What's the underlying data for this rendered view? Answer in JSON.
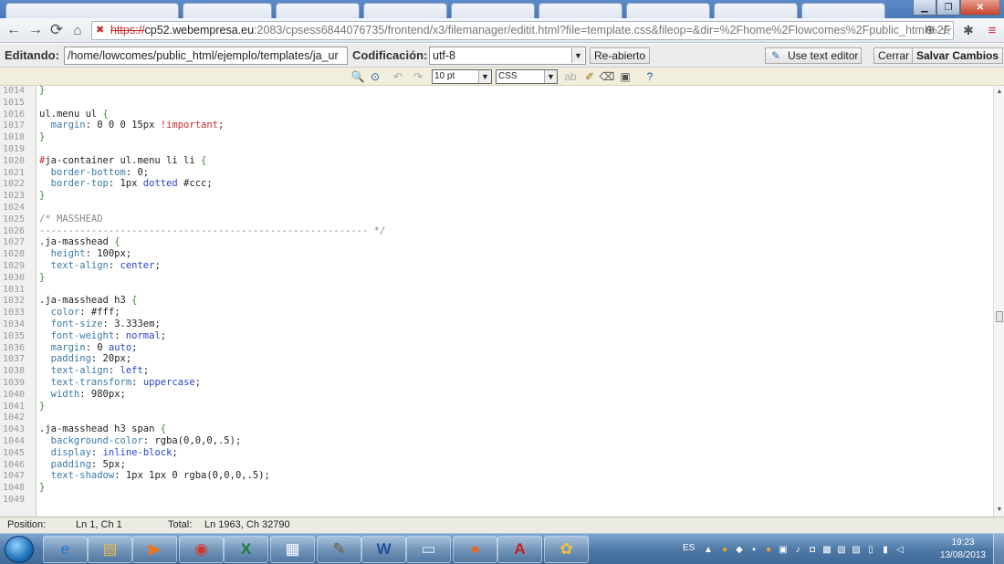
{
  "browser": {
    "url_scheme": "https://",
    "url_host": "cp52.webempresa.eu",
    "url_rest": ":2083/cpsess6844076735/frontend/x3/filemanager/editit.html?file=template.css&fileop=&dir=%2Fhome%2Flowcomes%2Fpublic_html%2F",
    "icons": {
      "back": "back-arrow-icon",
      "forward": "forward-arrow-icon",
      "reload": "reload-icon",
      "home": "home-icon",
      "lock": "broken-lock-icon",
      "zoom": "zoom-icon",
      "star": "star-icon",
      "menu": "menu-icon"
    }
  },
  "editor_toolbar": {
    "editing_label": "Editando:",
    "path_value": "/home/lowcomes/public_html/ejemplo/templates/ja_ur",
    "encoding_label": "Codificación:",
    "encoding_value": "utf-8",
    "reopen_button": "Re-abierto",
    "use_text_editor_button": "Use text editor",
    "close_button": "Cerrar",
    "save_button": "Salvar Cambios"
  },
  "code_toolbar": {
    "font_size": "10 pt",
    "syntax": "CSS"
  },
  "code_lines": [
    {
      "n": "1014",
      "parts": [
        {
          "c": "t-br",
          "t": "}"
        }
      ]
    },
    {
      "n": "1015",
      "parts": []
    },
    {
      "n": "1016",
      "parts": [
        {
          "c": "t-sel",
          "t": "ul.menu ul "
        },
        {
          "c": "t-br",
          "t": "{"
        }
      ]
    },
    {
      "n": "1017",
      "parts": [
        {
          "c": "t-prop",
          "t": "  margin"
        },
        {
          "c": "t-val",
          "t": ": 0 0 0 15px "
        },
        {
          "c": "t-imp",
          "t": "!important"
        },
        {
          "c": "t-val",
          "t": ";"
        }
      ]
    },
    {
      "n": "1018",
      "parts": [
        {
          "c": "t-br",
          "t": "}"
        }
      ]
    },
    {
      "n": "1019",
      "parts": []
    },
    {
      "n": "1020",
      "parts": [
        {
          "c": "t-hash",
          "t": "#"
        },
        {
          "c": "t-sel",
          "t": "ja-container ul.menu li li "
        },
        {
          "c": "t-br",
          "t": "{"
        }
      ]
    },
    {
      "n": "1021",
      "parts": [
        {
          "c": "t-prop",
          "t": "  border-bottom"
        },
        {
          "c": "t-val",
          "t": ": 0;"
        }
      ]
    },
    {
      "n": "1022",
      "parts": [
        {
          "c": "t-prop",
          "t": "  border-top"
        },
        {
          "c": "t-val",
          "t": ": 1px "
        },
        {
          "c": "t-kw",
          "t": "dotted"
        },
        {
          "c": "t-val",
          "t": " #ccc;"
        }
      ]
    },
    {
      "n": "1023",
      "parts": [
        {
          "c": "t-br",
          "t": "}"
        }
      ]
    },
    {
      "n": "1024",
      "parts": []
    },
    {
      "n": "1025",
      "parts": [
        {
          "c": "t-cm",
          "t": "/* MASSHEAD"
        }
      ]
    },
    {
      "n": "1026",
      "parts": [
        {
          "c": "t-cm",
          "t": "--------------------------------------------------------- */"
        }
      ]
    },
    {
      "n": "1027",
      "parts": [
        {
          "c": "t-sel",
          "t": ".ja-masshead "
        },
        {
          "c": "t-br",
          "t": "{"
        }
      ]
    },
    {
      "n": "1028",
      "parts": [
        {
          "c": "t-prop",
          "t": "  height"
        },
        {
          "c": "t-val",
          "t": ": 100px;"
        }
      ]
    },
    {
      "n": "1029",
      "parts": [
        {
          "c": "t-prop",
          "t": "  text-align"
        },
        {
          "c": "t-val",
          "t": ": "
        },
        {
          "c": "t-kw",
          "t": "center"
        },
        {
          "c": "t-val",
          "t": ";"
        }
      ]
    },
    {
      "n": "1030",
      "parts": [
        {
          "c": "t-br",
          "t": "}"
        }
      ]
    },
    {
      "n": "1031",
      "parts": []
    },
    {
      "n": "1032",
      "parts": [
        {
          "c": "t-sel",
          "t": ".ja-masshead h3 "
        },
        {
          "c": "t-br",
          "t": "{"
        }
      ]
    },
    {
      "n": "1033",
      "parts": [
        {
          "c": "t-prop",
          "t": "  color"
        },
        {
          "c": "t-val",
          "t": ": #fff;"
        }
      ]
    },
    {
      "n": "1034",
      "parts": [
        {
          "c": "t-prop",
          "t": "  font-size"
        },
        {
          "c": "t-val",
          "t": ": 3.333em;"
        }
      ]
    },
    {
      "n": "1035",
      "parts": [
        {
          "c": "t-prop",
          "t": "  font-weight"
        },
        {
          "c": "t-val",
          "t": ": "
        },
        {
          "c": "t-kw",
          "t": "normal"
        },
        {
          "c": "t-val",
          "t": ";"
        }
      ]
    },
    {
      "n": "1036",
      "parts": [
        {
          "c": "t-prop",
          "t": "  margin"
        },
        {
          "c": "t-val",
          "t": ": 0 "
        },
        {
          "c": "t-kw",
          "t": "auto"
        },
        {
          "c": "t-val",
          "t": ";"
        }
      ]
    },
    {
      "n": "1037",
      "parts": [
        {
          "c": "t-prop",
          "t": "  padding"
        },
        {
          "c": "t-val",
          "t": ": 20px;"
        }
      ]
    },
    {
      "n": "1038",
      "parts": [
        {
          "c": "t-prop",
          "t": "  text-align"
        },
        {
          "c": "t-val",
          "t": ": "
        },
        {
          "c": "t-kw",
          "t": "left"
        },
        {
          "c": "t-val",
          "t": ";"
        }
      ]
    },
    {
      "n": "1039",
      "parts": [
        {
          "c": "t-prop",
          "t": "  text-transform"
        },
        {
          "c": "t-val",
          "t": ": "
        },
        {
          "c": "t-kw",
          "t": "uppercase"
        },
        {
          "c": "t-val",
          "t": ";"
        }
      ]
    },
    {
      "n": "1040",
      "parts": [
        {
          "c": "t-prop",
          "t": "  width"
        },
        {
          "c": "t-val",
          "t": ": 980px;"
        }
      ]
    },
    {
      "n": "1041",
      "parts": [
        {
          "c": "t-br",
          "t": "}"
        }
      ]
    },
    {
      "n": "1042",
      "parts": []
    },
    {
      "n": "1043",
      "parts": [
        {
          "c": "t-sel",
          "t": ".ja-masshead h3 span "
        },
        {
          "c": "t-br",
          "t": "{"
        }
      ]
    },
    {
      "n": "1044",
      "parts": [
        {
          "c": "t-prop",
          "t": "  background-color"
        },
        {
          "c": "t-val",
          "t": ": rgba(0,0,0,.5);"
        }
      ]
    },
    {
      "n": "1045",
      "parts": [
        {
          "c": "t-prop",
          "t": "  display"
        },
        {
          "c": "t-val",
          "t": ": "
        },
        {
          "c": "t-kw",
          "t": "inline-block"
        },
        {
          "c": "t-val",
          "t": ";"
        }
      ]
    },
    {
      "n": "1046",
      "parts": [
        {
          "c": "t-prop",
          "t": "  padding"
        },
        {
          "c": "t-val",
          "t": ": 5px;"
        }
      ]
    },
    {
      "n": "1047",
      "parts": [
        {
          "c": "t-prop",
          "t": "  text-shadow"
        },
        {
          "c": "t-val",
          "t": ": 1px 1px 0 rgba(0,0,0,.5);"
        }
      ]
    },
    {
      "n": "1048",
      "parts": [
        {
          "c": "t-br",
          "t": "}"
        }
      ]
    },
    {
      "n": "1049",
      "parts": []
    }
  ],
  "status": {
    "position_label": "Position:",
    "position_value": "Ln 1, Ch 1",
    "total_label": "Total:",
    "total_value": "Ln 1963, Ch 32790"
  },
  "taskbar": {
    "language": "ES",
    "time": "19:23",
    "date": "13/08/2013",
    "apps": [
      "ie-icon",
      "explorer-folder-icon",
      "media-player-icon",
      "chrome-icon",
      "excel-icon",
      "remote-desktop-icon",
      "gimp-icon",
      "word-icon",
      "notepad-icon",
      "firefox-icon",
      "acrobat-icon",
      "paint-icon"
    ]
  }
}
